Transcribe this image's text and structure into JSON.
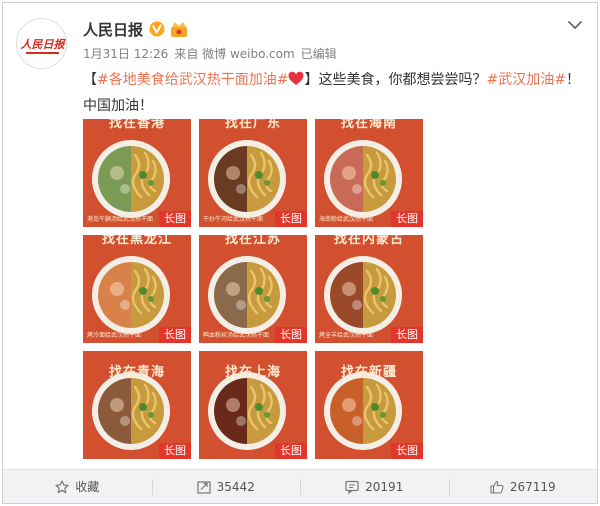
{
  "post": {
    "username": "人民日报",
    "logo_text": "人民日报",
    "meta": {
      "date": "1月31日 12:26",
      "via": "来自 微博 weibo.com",
      "edited": "已编辑"
    },
    "text": {
      "open_bracket": "【",
      "hashtag1": "#各地美食给武汉热干面加油#",
      "close_bracket": "】",
      "body": "这些美食，你都想尝尝吗？",
      "hashtag2": "#武汉加油#",
      "tail": "！中国加油！"
    }
  },
  "tiles": [
    {
      "title": "找在香港",
      "caption": "港岛牛腩汤给武汉热干面",
      "badge": "长图",
      "left": "#7a9a55",
      "row": 0,
      "col": 0
    },
    {
      "title": "找在广东",
      "caption": "干炒牛河给武汉热干面",
      "badge": "长图",
      "left": "#6b3a22",
      "row": 0,
      "col": 1
    },
    {
      "title": "找在海南",
      "caption": "海南粉给武汉热干面",
      "badge": "长图",
      "left": "#c86a55",
      "row": 0,
      "col": 2
    },
    {
      "title": "找在黑龙江",
      "caption": "烤冷面给武汉热干面",
      "badge": "长图",
      "left": "#d8824a",
      "row": 1,
      "col": 0
    },
    {
      "title": "找在江苏",
      "caption": "鸭血粉丝汤给武汉热干面",
      "badge": "长图",
      "left": "#8a6a4a",
      "row": 1,
      "col": 1
    },
    {
      "title": "找在内蒙古",
      "caption": "烤全羊给武汉热干面",
      "badge": "长图",
      "left": "#9a4a2a",
      "row": 1,
      "col": 2
    },
    {
      "title": "找在青海",
      "caption": "",
      "badge": "长图",
      "left": "#8a5a3a",
      "row": 2,
      "col": 0
    },
    {
      "title": "找在上海",
      "caption": "",
      "badge": "长图",
      "left": "#6a2a1a",
      "row": 2,
      "col": 1
    },
    {
      "title": "找在新疆",
      "caption": "",
      "badge": "长图",
      "left": "#c8602a",
      "row": 2,
      "col": 2
    }
  ],
  "actions": {
    "favorite": "收藏",
    "repost": "35442",
    "comment": "20191",
    "like": "267119"
  },
  "colors": {
    "accent": "#eb7350",
    "tile_bg": "#d2502f",
    "badge": "#e4352a",
    "verified": "#ffa41b"
  }
}
